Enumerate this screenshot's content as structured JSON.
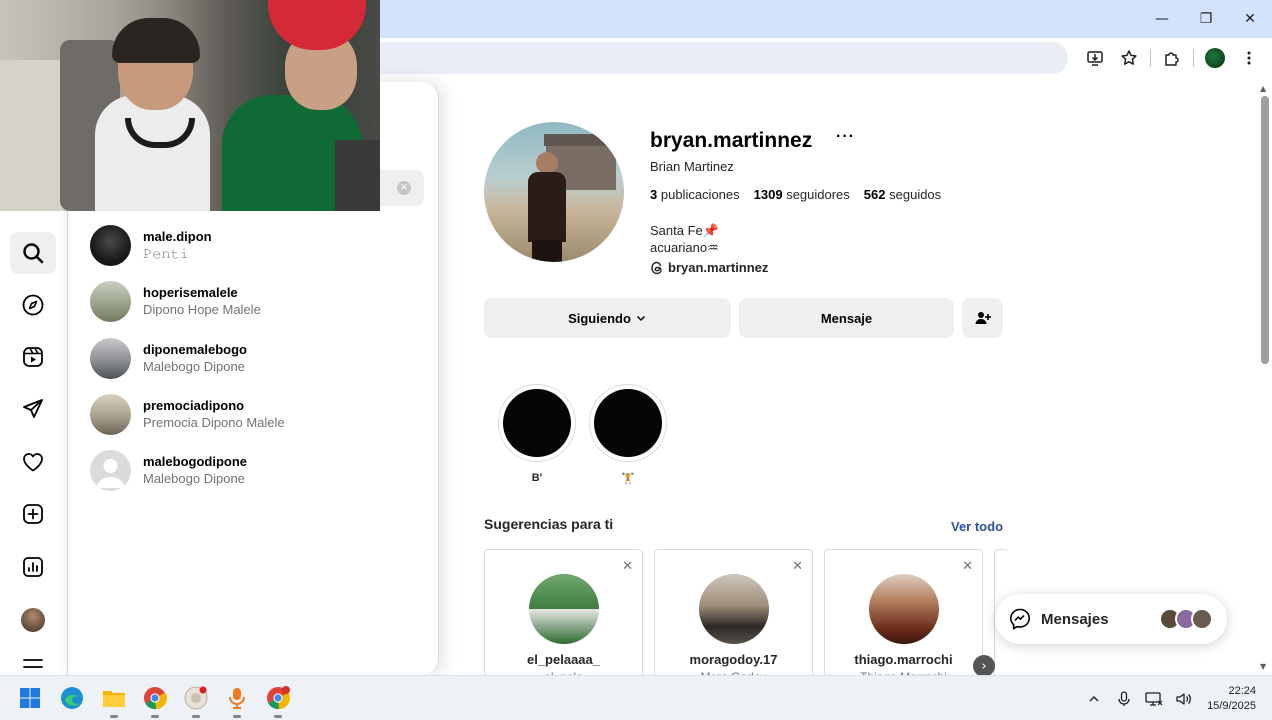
{
  "window": {
    "minimize_glyph": "—",
    "maximize_glyph": "❐",
    "close_glyph": "✕"
  },
  "toolbar_icons": [
    "install-app-icon",
    "bookmark-star-icon",
    "extensions-icon",
    "profile-avatar",
    "more-menu-icon"
  ],
  "rail": {
    "items": [
      {
        "name": "search-icon",
        "active": true
      },
      {
        "name": "explore-icon"
      },
      {
        "name": "reels-icon"
      },
      {
        "name": "messages-icon"
      },
      {
        "name": "notifications-icon"
      },
      {
        "name": "create-icon"
      },
      {
        "name": "dashboard-icon"
      },
      {
        "name": "profile-avatar"
      },
      {
        "name": "menu-icon"
      }
    ]
  },
  "search": {
    "clear_glyph": "✕",
    "results": [
      {
        "username": "male.dipon",
        "full_name": "𝙿𝚎𝚗𝚝𝚒",
        "avatar": "#1a1a1a"
      },
      {
        "username": "hoperisemalele",
        "full_name": "Dipono Hope Malele",
        "avatar": "#9aa38a"
      },
      {
        "username": "diponemalebogo",
        "full_name": "Malebogo Dipone",
        "avatar": "#8d8f94"
      },
      {
        "username": "premociadipono",
        "full_name": "Premocia Dipono Malele",
        "avatar": "#a9a08e"
      },
      {
        "username": "malebogodipone",
        "full_name": "Malebogo Dipone",
        "avatar": "#d9d9d9"
      }
    ]
  },
  "profile": {
    "username": "bryan.martinnez",
    "more": "···",
    "full_name": "Brian Martinez",
    "posts_count": "3",
    "posts_label": "publicaciones",
    "followers_count": "1309",
    "followers_label": "seguidores",
    "following_count": "562",
    "following_label": "seguidos",
    "bio_line1": "Santa Fe📌",
    "bio_line2": "acuariano♒",
    "threads_handle": "bryan.martinnez",
    "following_button": "Siguiendo",
    "message_button": "Mensaje"
  },
  "highlights": [
    {
      "label": "B'"
    },
    {
      "label": "🏋"
    }
  ],
  "suggestions": {
    "title": "Sugerencias para ti",
    "see_all": "Ver todo",
    "close_glyph": "✕",
    "next_glyph": "›",
    "cards": [
      {
        "username": "el_pelaaaa_",
        "subtitle": "el_pela",
        "avatar": "#4b8a4b"
      },
      {
        "username": "moragodoy.17",
        "subtitle": "Mora Godoy",
        "avatar": "#8a7a6a"
      },
      {
        "username": "thiago.marrochi",
        "subtitle": "Thiago Marrochi",
        "avatar": "#7a3020"
      }
    ]
  },
  "messages_pill": {
    "label": "Mensajes",
    "avatars": [
      "#5a4a3a",
      "#8a6aa0",
      "#6a5a50"
    ]
  },
  "taskbar": {
    "apps": [
      "windows-start-icon",
      "edge-icon",
      "file-explorer-icon",
      "chrome-icon",
      "obs-icon",
      "podcast-mic-icon",
      "chrome-profile-icon"
    ],
    "time": "22:24",
    "date": "15/9/2025"
  }
}
